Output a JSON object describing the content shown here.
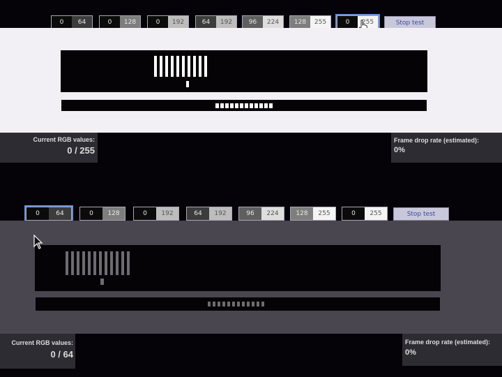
{
  "top": {
    "buttons": [
      {
        "a": "0",
        "b": "64",
        "ac": "#0b0b0b",
        "bc": "#3c3c3c",
        "selected": false
      },
      {
        "a": "0",
        "b": "128",
        "ac": "#0b0b0b",
        "bc": "#7e7e7e",
        "selected": false
      },
      {
        "a": "0",
        "b": "192",
        "ac": "#0b0b0b",
        "bc": "#bdbdbd",
        "selected": false
      },
      {
        "a": "64",
        "b": "192",
        "ac": "#3c3c3c",
        "bc": "#bdbdbd",
        "selected": false
      },
      {
        "a": "96",
        "b": "224",
        "ac": "#5f5f5f",
        "bc": "#dedede",
        "selected": false
      },
      {
        "a": "128",
        "b": "255",
        "ac": "#7e7e7e",
        "bc": "#f4f4f4",
        "selected": false
      },
      {
        "a": "0",
        "b": "255",
        "ac": "#0b0b0b",
        "bc": "#f4f4f4",
        "selected": true
      }
    ],
    "stop_label": "Stop test",
    "current_label": "Current RGB values:",
    "current_value": "0 / 255",
    "drop_label": "Frame drop rate (estimated):",
    "drop_value": "0%",
    "bg": "#f2f0f5",
    "fg": "#ffffff"
  },
  "bottom": {
    "buttons": [
      {
        "a": "0",
        "b": "64",
        "ac": "#0b0b0b",
        "bc": "#3c3c3c",
        "selected": true
      },
      {
        "a": "0",
        "b": "128",
        "ac": "#0b0b0b",
        "bc": "#7e7e7e",
        "selected": false
      },
      {
        "a": "0",
        "b": "192",
        "ac": "#0b0b0b",
        "bc": "#bdbdbd",
        "selected": false
      },
      {
        "a": "64",
        "b": "192",
        "ac": "#3c3c3c",
        "bc": "#bdbdbd",
        "selected": false
      },
      {
        "a": "96",
        "b": "224",
        "ac": "#5f5f5f",
        "bc": "#dedede",
        "selected": false
      },
      {
        "a": "128",
        "b": "255",
        "ac": "#7e7e7e",
        "bc": "#f4f4f4",
        "selected": false
      },
      {
        "a": "0",
        "b": "255",
        "ac": "#0b0b0b",
        "bc": "#f4f4f4",
        "selected": false
      }
    ],
    "stop_label": "Stop test",
    "current_label": "Current RGB values:",
    "current_value": "0 / 64",
    "drop_label": "Frame drop rate (estimated):",
    "drop_value": "0%",
    "bg": "#4a4650",
    "fg": "#6e6b72"
  },
  "icons": {
    "pointer": "mouse-pointer-icon",
    "hand": "hand-cursor-icon"
  }
}
